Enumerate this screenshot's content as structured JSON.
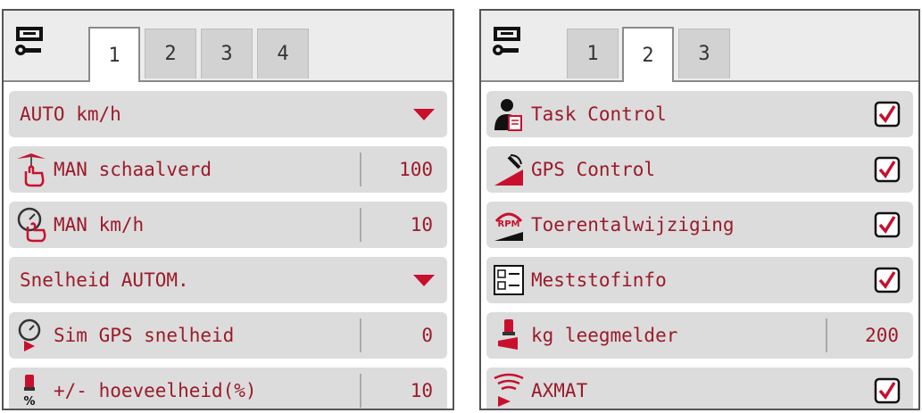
{
  "left_panel": {
    "tabs": [
      "1",
      "2",
      "3",
      "4"
    ],
    "active_tab": "1",
    "rows": [
      {
        "label": "AUTO km/h",
        "control": "dropdown"
      },
      {
        "label": "MAN schaalverd",
        "value": "100",
        "icon": "hand-scale-icon"
      },
      {
        "label": "MAN km/h",
        "value": "10",
        "icon": "hand-speedometer-icon"
      },
      {
        "label": "Snelheid AUTOM.",
        "control": "dropdown"
      },
      {
        "label": "Sim GPS snelheid",
        "value": "0",
        "icon": "speedometer-play-icon"
      },
      {
        "label": "+/- hoeveelheid(%)",
        "value": "10",
        "icon": "weight-percent-icon"
      }
    ]
  },
  "right_panel": {
    "tabs": [
      "1",
      "2",
      "3"
    ],
    "active_tab": "2",
    "rows": [
      {
        "label": "Task Control",
        "checked": true,
        "icon": "person-document-icon"
      },
      {
        "label": "GPS Control",
        "checked": true,
        "icon": "satellite-field-icon"
      },
      {
        "label": "Toerentalwijziging",
        "checked": true,
        "icon": "rpm-icon"
      },
      {
        "label": "Meststofinfo",
        "checked": true,
        "icon": "checklist-icon"
      },
      {
        "label": "kg leegmelder",
        "value": "200",
        "icon": "weight-horn-icon"
      },
      {
        "label": "AXMAT",
        "checked": true,
        "icon": "wifi-sensor-icon"
      }
    ]
  },
  "colors": {
    "text": "#9b1b2a",
    "accent": "#c8102e",
    "row_bg": "#dcdcdc"
  }
}
